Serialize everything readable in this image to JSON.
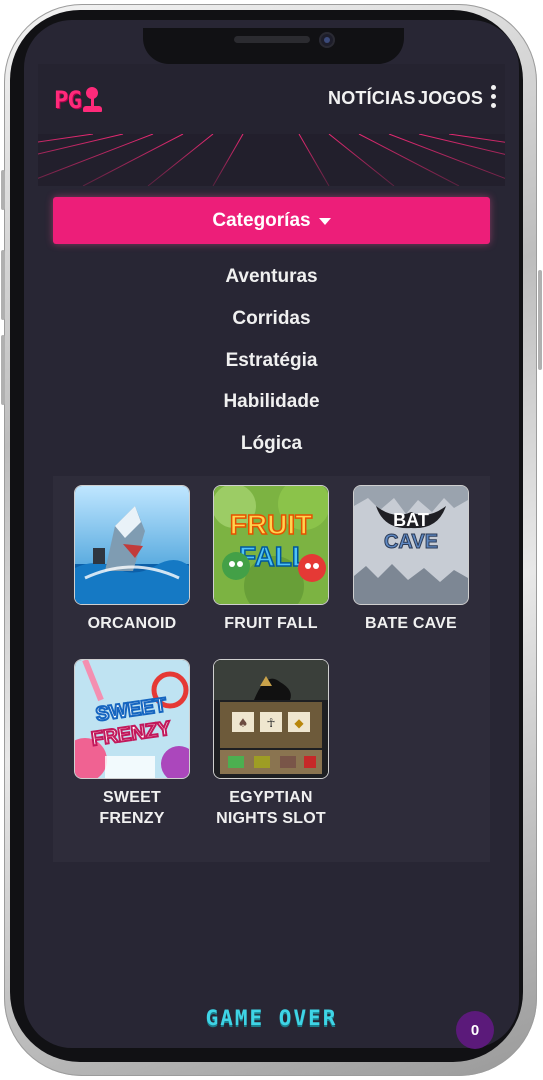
{
  "brand": {
    "logo_text": "PG",
    "accent_color": "#ed1e79",
    "icon": "joystick-icon"
  },
  "nav": {
    "items": [
      {
        "label": "NOTÍCIAS"
      },
      {
        "label": "JOGOS"
      }
    ],
    "more_icon": "kebab-menu-icon"
  },
  "categories": {
    "button_label": "Categorías",
    "items": [
      {
        "label": "Aventuras"
      },
      {
        "label": "Corridas"
      },
      {
        "label": "Estratégia"
      },
      {
        "label": "Habilidade"
      },
      {
        "label": "Lógica"
      }
    ]
  },
  "games": [
    {
      "title": "ORCANOID",
      "thumb_text": ""
    },
    {
      "title": "FRUIT FALL",
      "thumb_text": "FRUIT FALL"
    },
    {
      "title": "BATE CAVE",
      "thumb_text": "BAT CAVE"
    },
    {
      "title": "SWEET FRENZY",
      "thumb_text": "SWEET FRENZY"
    },
    {
      "title": "EGYPTIAN NIGHTS SLOT",
      "thumb_text": ""
    }
  ],
  "footer": {
    "game_over": "GAME OVER",
    "badge_count": "0",
    "game_over_color": "#3fd4e6"
  }
}
